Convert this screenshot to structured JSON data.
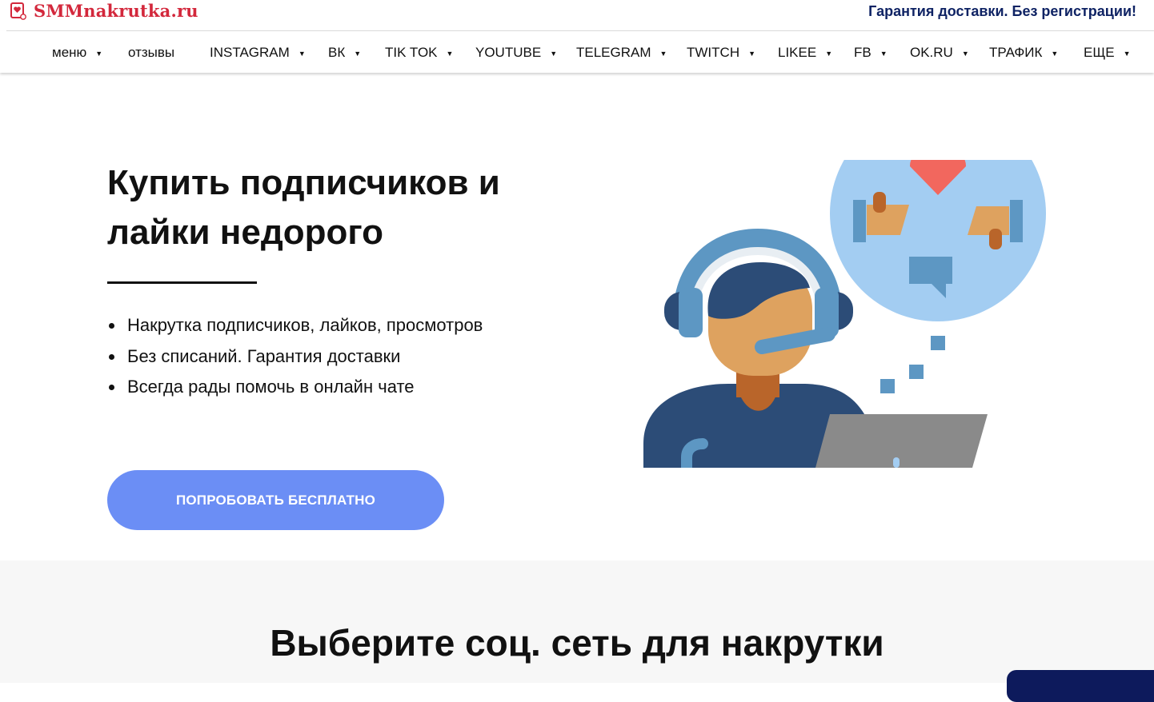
{
  "header": {
    "logo_text": "SMMnakrutka.ru",
    "tagline": "Гарантия доставки. Без регистрации!"
  },
  "nav": {
    "items": [
      {
        "label": "меню",
        "dropdown": true
      },
      {
        "label": "отзывы",
        "dropdown": false
      },
      {
        "label": "INSTAGRAM",
        "dropdown": true
      },
      {
        "label": "ВК",
        "dropdown": true
      },
      {
        "label": "TIK TOK",
        "dropdown": true
      },
      {
        "label": "YOUTUBE",
        "dropdown": true
      },
      {
        "label": "TELEGRAM",
        "dropdown": true
      },
      {
        "label": "TWITCH",
        "dropdown": true
      },
      {
        "label": "LIKEE",
        "dropdown": true
      },
      {
        "label": "FB",
        "dropdown": true
      },
      {
        "label": "OK.RU",
        "dropdown": true
      },
      {
        "label": "ТРАФИК",
        "dropdown": true
      },
      {
        "label": "ЕЩЕ",
        "dropdown": true
      }
    ],
    "dropdown_glyph": "▼"
  },
  "hero": {
    "title_line1": "Купить подписчиков и",
    "title_line2": "лайки недорого",
    "bullets": [
      "Накрутка подписчиков, лайков, просмотров",
      "Без списаний. Гарантия доставки",
      "Всегда рады помочь в онлайн чате"
    ],
    "cta_label": "ПОПРОБОВАТЬ БЕСПЛАТНО",
    "illustration": "support-operator-illustration"
  },
  "section2": {
    "title": "Выберите соц. сеть для накрутки"
  },
  "colors": {
    "brand_red": "#d3283c",
    "tagline_navy": "#0f2364",
    "cta_blue": "#6b8ef5",
    "section_bg": "#f7f7f7",
    "chat_widget": "#0d1a5c"
  }
}
